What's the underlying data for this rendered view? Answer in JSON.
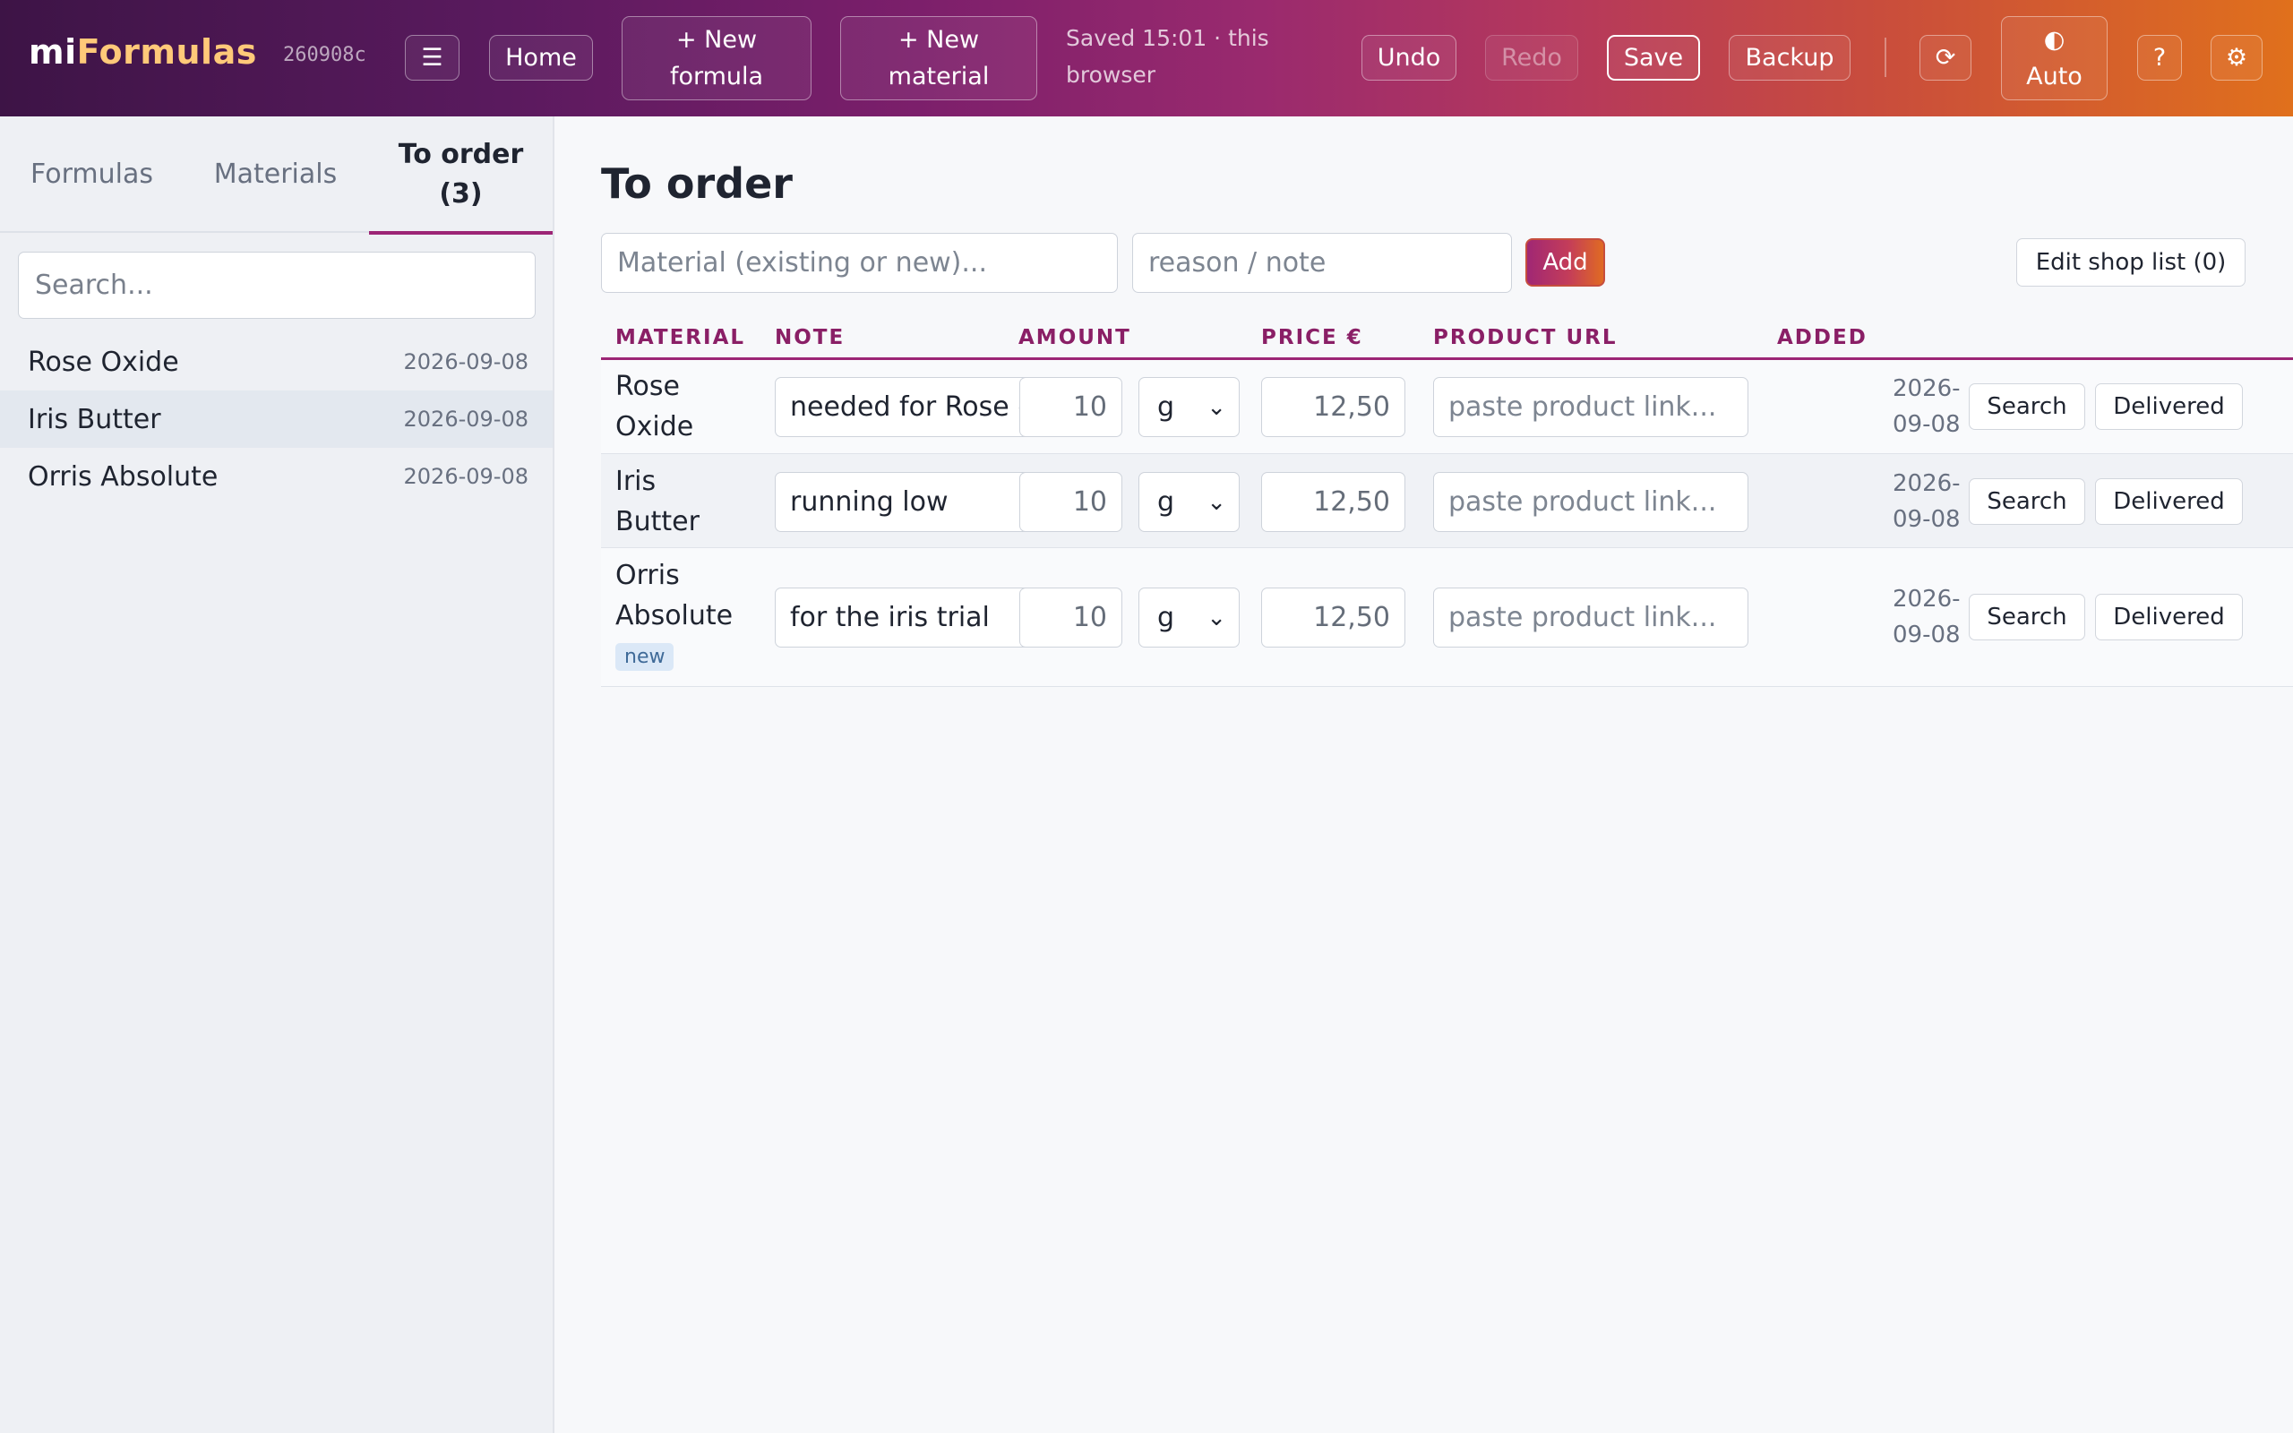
{
  "app": {
    "logo_mi": "mi",
    "logo_formulas": "Formulas",
    "build": "260908c",
    "menu_icon": "☰",
    "home": "Home",
    "new_formula_1": "+ New",
    "new_formula_2": "formula",
    "new_material_1": "+ New",
    "new_material_2": "material",
    "saved_1": "Saved 15:01 · this",
    "saved_2": "browser",
    "undo": "Undo",
    "redo": "Redo",
    "save": "Save",
    "backup": "Backup",
    "refresh_icon": "⟳",
    "theme_icon": "◐",
    "theme_label": "Auto",
    "help": "?",
    "settings_icon": "⚙"
  },
  "sidebar": {
    "tabs": [
      {
        "label": "Formulas"
      },
      {
        "label": "Materials"
      },
      {
        "label_1": "To order",
        "label_2": "(3)"
      }
    ],
    "search_placeholder": "Search...",
    "items": [
      {
        "name": "Rose Oxide",
        "date": "2026-09-08"
      },
      {
        "name": "Iris Butter",
        "date": "2026-09-08"
      },
      {
        "name": "Orris Absolute",
        "date": "2026-09-08"
      }
    ]
  },
  "main": {
    "title": "To order",
    "material_placeholder": "Material (existing or new)...",
    "reason_placeholder": "reason / note",
    "add_label": "Add",
    "shop_list_label": "Edit shop list (0)",
    "columns": [
      "MATERIAL",
      "NOTE",
      "AMOUNT",
      "PRICE €",
      "PRODUCT URL",
      "ADDED"
    ],
    "rows": [
      {
        "name_1": "Rose",
        "name_2": "Oxide",
        "note": "needed for Rose de",
        "amount": "10",
        "unit": "g",
        "price": "12,50",
        "url_placeholder": "paste product link...",
        "added_1": "2026-",
        "added_2": "09-08",
        "search": "Search",
        "delivered": "Delivered",
        "remove": "×"
      },
      {
        "name_1": "Iris",
        "name_2": "Butter",
        "note": "running low",
        "amount": "10",
        "unit": "g",
        "price": "12,50",
        "url_placeholder": "paste product link...",
        "added_1": "2026-",
        "added_2": "09-08",
        "search": "Search",
        "delivered": "Delivered",
        "remove": "×"
      },
      {
        "name_1": "Orris",
        "name_2": "Absolute",
        "tag": "new",
        "note": "for the iris trial",
        "amount": "10",
        "unit": "g",
        "price": "12,50",
        "url_placeholder": "paste product link...",
        "added_1": "2026-",
        "added_2": "09-08",
        "search": "Search",
        "delivered": "Delivered",
        "remove": "×"
      }
    ]
  },
  "colors": {
    "accent": "#9c2575",
    "header_start": "#3d1446",
    "header_end": "#e0701c",
    "logo_highlight": "#ffc979"
  }
}
